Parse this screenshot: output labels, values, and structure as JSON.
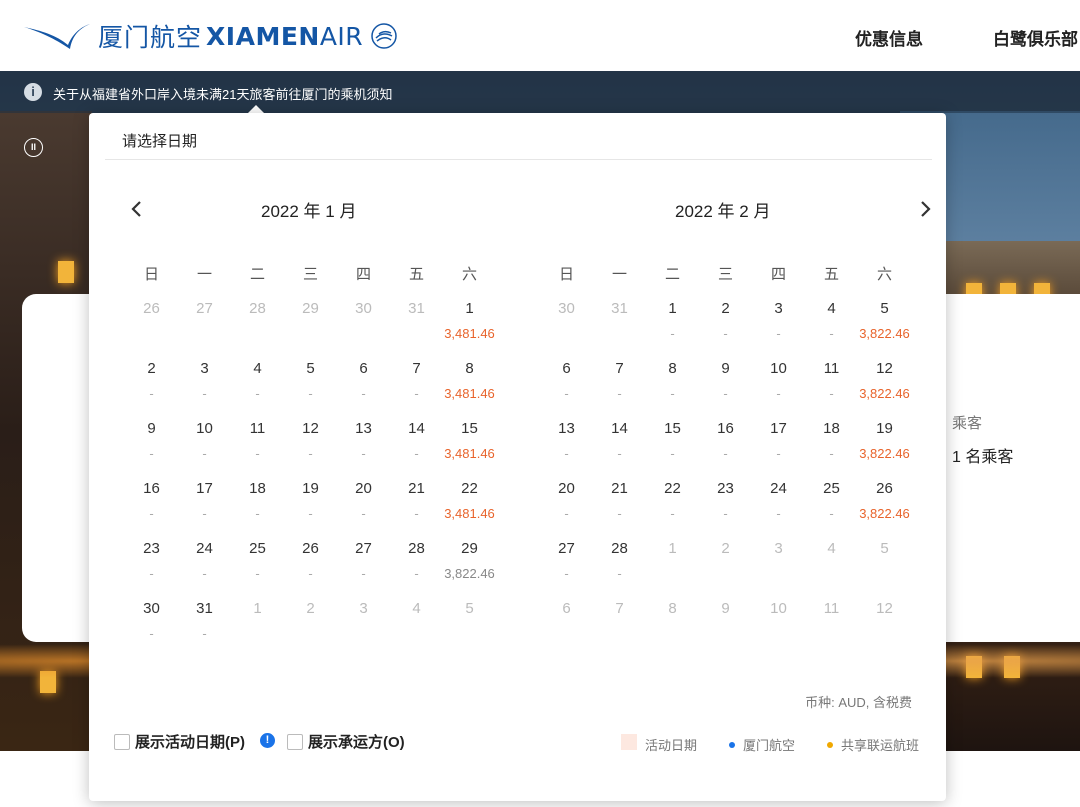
{
  "header": {
    "logo_cn": "厦门航空",
    "logo_en_bold": "XIAMEN",
    "logo_en_light": "AIR",
    "nav": [
      "优惠信息",
      "白鹭俱乐部"
    ]
  },
  "notice": {
    "text": "关于从福建省外口岸入境未满21天旅客前往厦门的乘机须知"
  },
  "search": {
    "passengers_label": "乘客",
    "passengers_value": "1 名乘客"
  },
  "picker": {
    "title": "请选择日期",
    "weekdays": [
      "日",
      "一",
      "二",
      "三",
      "四",
      "五",
      "六"
    ],
    "months": [
      {
        "title": "2022 年 1 月",
        "weeks": [
          [
            {
              "d": "26",
              "o": true
            },
            {
              "d": "27",
              "o": true
            },
            {
              "d": "28",
              "o": true
            },
            {
              "d": "29",
              "o": true
            },
            {
              "d": "30",
              "o": true
            },
            {
              "d": "31",
              "o": true
            },
            {
              "d": "1",
              "p": "3,481.46",
              "c": "orange"
            }
          ],
          [
            {
              "d": "2",
              "p": "-"
            },
            {
              "d": "3",
              "p": "-"
            },
            {
              "d": "4",
              "p": "-"
            },
            {
              "d": "5",
              "p": "-"
            },
            {
              "d": "6",
              "p": "-"
            },
            {
              "d": "7",
              "p": "-"
            },
            {
              "d": "8",
              "p": "3,481.46",
              "c": "orange"
            }
          ],
          [
            {
              "d": "9",
              "p": "-"
            },
            {
              "d": "10",
              "p": "-"
            },
            {
              "d": "11",
              "p": "-"
            },
            {
              "d": "12",
              "p": "-"
            },
            {
              "d": "13",
              "p": "-"
            },
            {
              "d": "14",
              "p": "-"
            },
            {
              "d": "15",
              "p": "3,481.46",
              "c": "orange"
            }
          ],
          [
            {
              "d": "16",
              "p": "-"
            },
            {
              "d": "17",
              "p": "-"
            },
            {
              "d": "18",
              "p": "-"
            },
            {
              "d": "19",
              "p": "-"
            },
            {
              "d": "20",
              "p": "-"
            },
            {
              "d": "21",
              "p": "-"
            },
            {
              "d": "22",
              "p": "3,481.46",
              "c": "orange"
            }
          ],
          [
            {
              "d": "23",
              "p": "-"
            },
            {
              "d": "24",
              "p": "-"
            },
            {
              "d": "25",
              "p": "-"
            },
            {
              "d": "26",
              "p": "-"
            },
            {
              "d": "27",
              "p": "-"
            },
            {
              "d": "28",
              "p": "-"
            },
            {
              "d": "29",
              "p": "3,822.46",
              "c": "gray"
            }
          ],
          [
            {
              "d": "30",
              "p": "-"
            },
            {
              "d": "31",
              "p": "-"
            },
            {
              "d": "1",
              "o": true
            },
            {
              "d": "2",
              "o": true
            },
            {
              "d": "3",
              "o": true
            },
            {
              "d": "4",
              "o": true
            },
            {
              "d": "5",
              "o": true
            }
          ]
        ]
      },
      {
        "title": "2022 年 2 月",
        "weeks": [
          [
            {
              "d": "30",
              "o": true
            },
            {
              "d": "31",
              "o": true
            },
            {
              "d": "1",
              "p": "-"
            },
            {
              "d": "2",
              "p": "-"
            },
            {
              "d": "3",
              "p": "-"
            },
            {
              "d": "4",
              "p": "-"
            },
            {
              "d": "5",
              "p": "3,822.46",
              "c": "orange"
            }
          ],
          [
            {
              "d": "6",
              "p": "-"
            },
            {
              "d": "7",
              "p": "-"
            },
            {
              "d": "8",
              "p": "-"
            },
            {
              "d": "9",
              "p": "-"
            },
            {
              "d": "10",
              "p": "-"
            },
            {
              "d": "11",
              "p": "-"
            },
            {
              "d": "12",
              "p": "3,822.46",
              "c": "orange"
            }
          ],
          [
            {
              "d": "13",
              "p": "-"
            },
            {
              "d": "14",
              "p": "-"
            },
            {
              "d": "15",
              "p": "-"
            },
            {
              "d": "16",
              "p": "-"
            },
            {
              "d": "17",
              "p": "-"
            },
            {
              "d": "18",
              "p": "-"
            },
            {
              "d": "19",
              "p": "3,822.46",
              "c": "orange"
            }
          ],
          [
            {
              "d": "20",
              "p": "-"
            },
            {
              "d": "21",
              "p": "-"
            },
            {
              "d": "22",
              "p": "-"
            },
            {
              "d": "23",
              "p": "-"
            },
            {
              "d": "24",
              "p": "-"
            },
            {
              "d": "25",
              "p": "-"
            },
            {
              "d": "26",
              "p": "3,822.46",
              "c": "orange"
            }
          ],
          [
            {
              "d": "27",
              "p": "-"
            },
            {
              "d": "28",
              "p": "-"
            },
            {
              "d": "1",
              "o": true
            },
            {
              "d": "2",
              "o": true
            },
            {
              "d": "3",
              "o": true
            },
            {
              "d": "4",
              "o": true
            },
            {
              "d": "5",
              "o": true
            }
          ],
          [
            {
              "d": "6",
              "o": true
            },
            {
              "d": "7",
              "o": true
            },
            {
              "d": "8",
              "o": true
            },
            {
              "d": "9",
              "o": true
            },
            {
              "d": "10",
              "o": true
            },
            {
              "d": "11",
              "o": true
            },
            {
              "d": "12",
              "o": true
            }
          ]
        ]
      }
    ],
    "currency_note": "币种: AUD, 含税费",
    "options": {
      "show_promo": "展示活动日期(P)",
      "show_carrier": "展示承运方(O)"
    },
    "legend": {
      "promo": "活动日期",
      "xiamen": "厦门航空",
      "codeshare": "共享联运航班"
    }
  },
  "colors": {
    "brand": "#1456a5",
    "price": "#e8642c",
    "xiamen_dot": "#1a73e8",
    "codeshare_dot": "#f0a800"
  },
  "icons": [
    "info-icon",
    "pause-icon",
    "chevron-left-icon",
    "chevron-right-icon",
    "help-icon"
  ]
}
